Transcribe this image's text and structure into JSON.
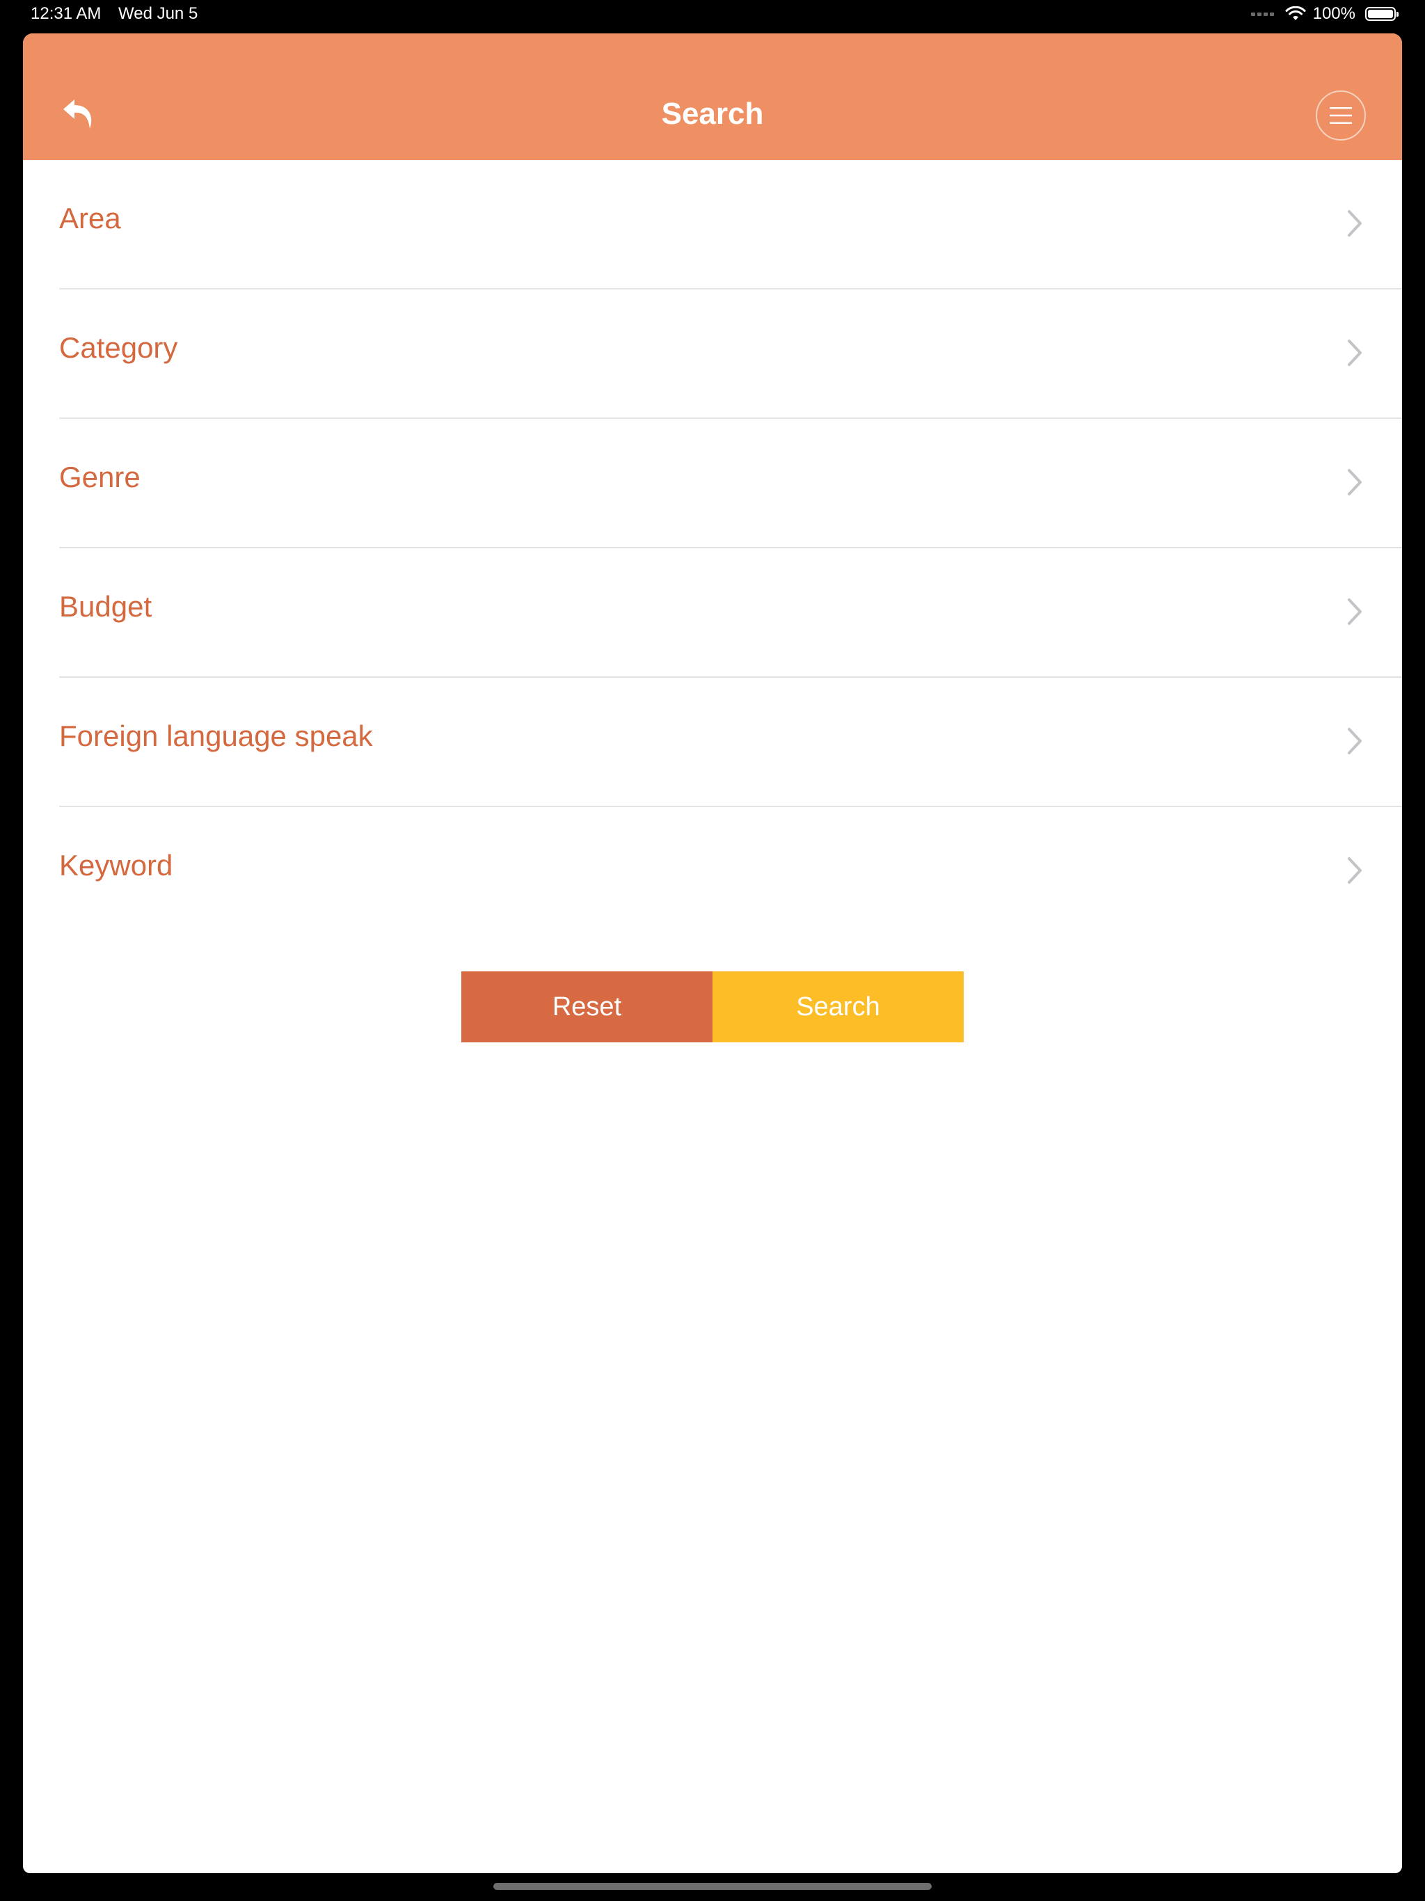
{
  "status_bar": {
    "time": "12:31 AM",
    "date": "Wed Jun 5",
    "battery": "100%",
    "battery_level": 1.0
  },
  "nav": {
    "title": "Search",
    "back_icon": "back-arrow-icon",
    "menu_icon": "hamburger-menu-icon"
  },
  "list": {
    "items": [
      {
        "label": "Area"
      },
      {
        "label": "Category"
      },
      {
        "label": "Genre"
      },
      {
        "label": "Budget"
      },
      {
        "label": "Foreign language speak"
      },
      {
        "label": "Keyword"
      }
    ],
    "chevron_icon": "chevron-right-icon"
  },
  "actions": {
    "reset_label": "Reset",
    "search_label": "Search"
  },
  "colors": {
    "nav_bg": "#ee9063",
    "label": "#d4683f",
    "reset_bg": "#d76a42",
    "search_bg": "#fdbd26"
  }
}
